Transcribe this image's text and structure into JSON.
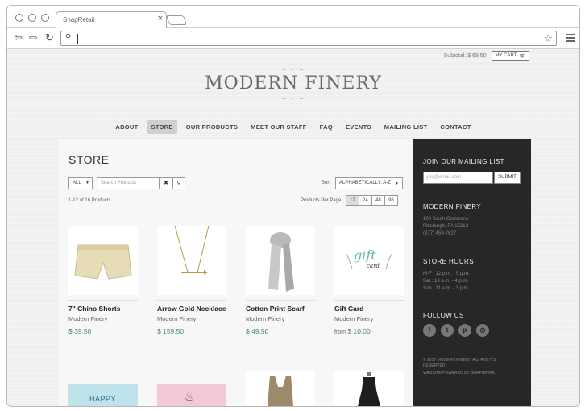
{
  "browser": {
    "tab_title": "SnapRetail",
    "tab_close": "×"
  },
  "cart": {
    "subtotal": "Subtotal: $ 69.50",
    "button_label": "MY CART"
  },
  "site": {
    "logo": "MODERN FINERY"
  },
  "nav": {
    "items": [
      "ABOUT",
      "STORE",
      "OUR PRODUCTS",
      "MEET OUR STAFF",
      "FAQ",
      "EVENTS",
      "MAILING LIST",
      "CONTACT"
    ],
    "active": "STORE"
  },
  "store": {
    "title": "STORE",
    "filter_value": "ALL",
    "search_placeholder": "Search Products",
    "sort_label": "Sort",
    "sort_value": "ALPHABETICALLY: A-Z",
    "count": "1-12 of 16 Products",
    "per_page_label": "Products Per Page",
    "per_page_options": [
      "12",
      "24",
      "48",
      "96"
    ],
    "per_page_selected": "12"
  },
  "products": [
    {
      "name": "7\" Chino Shorts",
      "brand": "Modern Finery",
      "price": "$ 39.50",
      "from": ""
    },
    {
      "name": "Arrow Gold Necklace",
      "brand": "Modern Finery",
      "price": "$ 159.50",
      "from": ""
    },
    {
      "name": "Cotton Print Scarf",
      "brand": "Modern Finery",
      "price": "$ 49.50",
      "from": ""
    },
    {
      "name": "Gift Card",
      "brand": "Modern Finery",
      "price": "$ 10.00",
      "from": "from"
    }
  ],
  "second_row_labels": {
    "card1": "HAPPY"
  },
  "sidebar": {
    "mailing_title": "JOIN OUR MAILING LIST",
    "email_placeholder": "you@email.com",
    "submit_label": "SUBMIT",
    "company_title": "MODERN FINERY",
    "address1": "100 South Commons",
    "address2": "Pittsburgh, PA 15212",
    "phone": "(877) 459-7627",
    "hours_title": "STORE HOURS",
    "hours1": "M-F : 12 p.m. - 5 p.m.",
    "hours2": "Sat : 10 a.m. - 4 p.m.",
    "hours3": "Sun : 11 a.m. - 3 p.m.",
    "follow_title": "FOLLOW US",
    "footer1": "© 2017 MODERN FINERY. ALL RIGHTS",
    "footer2": "RESERVED.",
    "footer3": "WEBSITE POWERED BY SNAPRETAIL"
  },
  "colors": {
    "price": "#4a8a6a",
    "sidebar_bg": "#272727",
    "nav_active_bg": "#cfcfcf"
  }
}
